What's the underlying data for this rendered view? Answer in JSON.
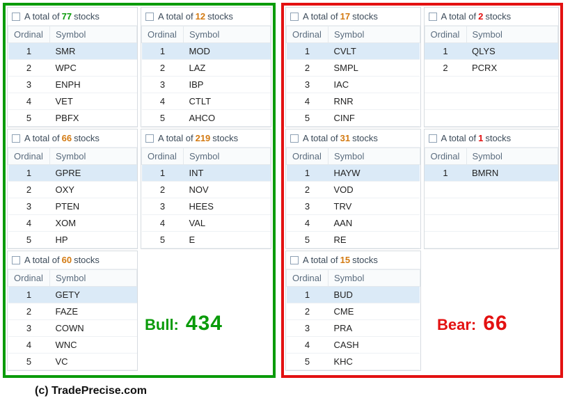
{
  "copyright": "(c) TradePrecise.com",
  "columns": {
    "ordinal": "Ordinal",
    "symbol": "Symbol"
  },
  "header_prefix": "A total of ",
  "header_suffix": " stocks",
  "bull": {
    "label": "Bull:",
    "total": "434",
    "color": "#0a9b0a",
    "left_col": [
      {
        "count": "77",
        "count_color": "#0a9b0a",
        "rows": [
          [
            "1",
            "SMR"
          ],
          [
            "2",
            "WPC"
          ],
          [
            "3",
            "ENPH"
          ],
          [
            "4",
            "VET"
          ],
          [
            "5",
            "PBFX"
          ]
        ]
      },
      {
        "count": "66",
        "count_color": "#d37a12",
        "rows": [
          [
            "1",
            "GPRE"
          ],
          [
            "2",
            "OXY"
          ],
          [
            "3",
            "PTEN"
          ],
          [
            "4",
            "XOM"
          ],
          [
            "5",
            "HP"
          ]
        ]
      },
      {
        "count": "60",
        "count_color": "#d37a12",
        "rows": [
          [
            "1",
            "GETY"
          ],
          [
            "2",
            "FAZE"
          ],
          [
            "3",
            "COWN"
          ],
          [
            "4",
            "WNC"
          ],
          [
            "5",
            "VC"
          ]
        ]
      }
    ],
    "right_col": [
      {
        "count": "12",
        "count_color": "#d37a12",
        "rows": [
          [
            "1",
            "MOD"
          ],
          [
            "2",
            "LAZ"
          ],
          [
            "3",
            "IBP"
          ],
          [
            "4",
            "CTLT"
          ],
          [
            "5",
            "AHCO"
          ]
        ]
      },
      {
        "count": "219",
        "count_color": "#d37a12",
        "rows": [
          [
            "1",
            "INT"
          ],
          [
            "2",
            "NOV"
          ],
          [
            "3",
            "HEES"
          ],
          [
            "4",
            "VAL"
          ],
          [
            "5",
            "E"
          ]
        ]
      }
    ]
  },
  "bear": {
    "label": "Bear:",
    "total": "66",
    "color": "#e31111",
    "left_col": [
      {
        "count": "17",
        "count_color": "#d37a12",
        "rows": [
          [
            "1",
            "CVLT"
          ],
          [
            "2",
            "SMPL"
          ],
          [
            "3",
            "IAC"
          ],
          [
            "4",
            "RNR"
          ],
          [
            "5",
            "CINF"
          ]
        ]
      },
      {
        "count": "31",
        "count_color": "#d37a12",
        "rows": [
          [
            "1",
            "HAYW"
          ],
          [
            "2",
            "VOD"
          ],
          [
            "3",
            "TRV"
          ],
          [
            "4",
            "AAN"
          ],
          [
            "5",
            "RE"
          ]
        ]
      },
      {
        "count": "15",
        "count_color": "#d37a12",
        "rows": [
          [
            "1",
            "BUD"
          ],
          [
            "2",
            "CME"
          ],
          [
            "3",
            "PRA"
          ],
          [
            "4",
            "CASH"
          ],
          [
            "5",
            "KHC"
          ]
        ]
      }
    ],
    "right_col": [
      {
        "count": "2",
        "count_color": "#e31111",
        "rows": [
          [
            "1",
            "QLYS"
          ],
          [
            "2",
            "PCRX"
          ]
        ],
        "pad_rows": 3
      },
      {
        "count": "1",
        "count_color": "#e31111",
        "rows": [
          [
            "1",
            "BMRN"
          ]
        ],
        "pad_rows": 4
      }
    ]
  }
}
